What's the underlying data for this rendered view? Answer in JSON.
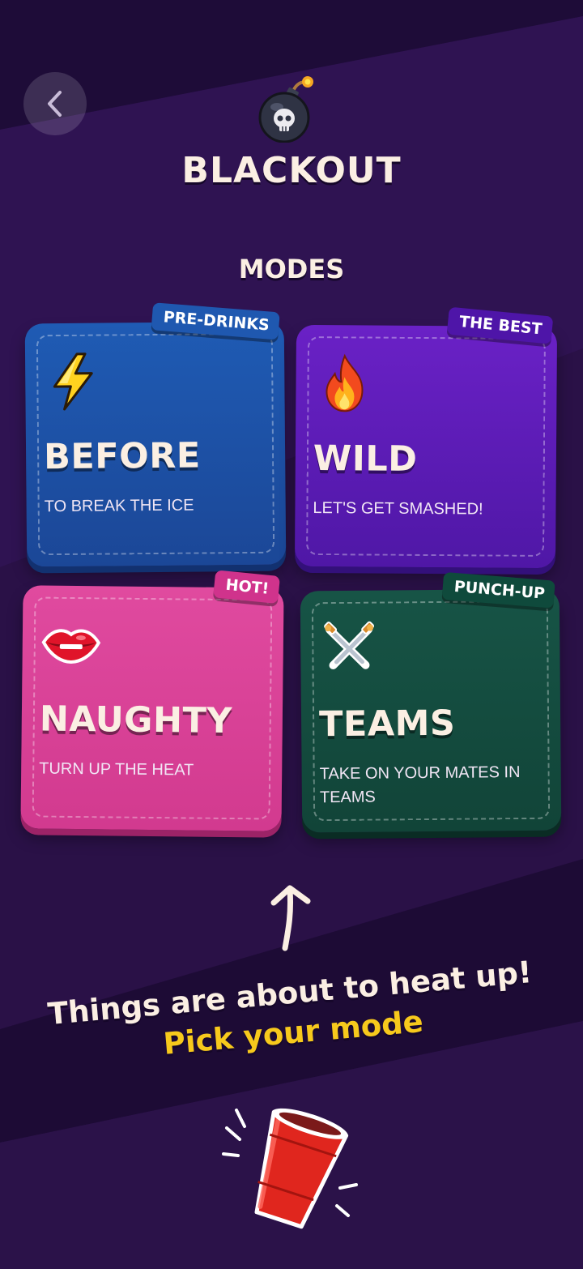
{
  "header": {
    "back_icon": "chevron-left-icon",
    "app_icon": "bomb-skull-icon",
    "title": "BLACKOUT"
  },
  "modes_section": {
    "title": "MODES",
    "cards": [
      {
        "id": "before",
        "badge": "PRE-DRINKS",
        "icon": "lightning-icon",
        "name": "BEFORE",
        "description": "TO BREAK THE ICE",
        "color": "#1f5bb4"
      },
      {
        "id": "wild",
        "badge": "THE BEST",
        "icon": "fire-icon",
        "name": "WILD",
        "description": "LET'S GET SMASHED!",
        "color": "#6a21c6"
      },
      {
        "id": "naughty",
        "badge": "HOT!",
        "icon": "lips-icon",
        "name": "NAUGHTY",
        "description": "TURN UP THE HEAT",
        "color": "#e04a9f"
      },
      {
        "id": "teams",
        "badge": "PUNCH-UP",
        "icon": "crossed-swords-icon",
        "name": "TEAMS",
        "description": "TAKE ON YOUR MATES IN TEAMS",
        "color": "#175446"
      }
    ]
  },
  "prompt": {
    "arrow_icon": "curved-arrow-up-icon",
    "line1": "Things are about to heat up!",
    "line2": "Pick your mode",
    "line2_color": "#f7c91c",
    "mascot_icon": "red-cup-icon"
  },
  "colors": {
    "background": "#2a1147",
    "text": "#fbefe3",
    "accent": "#f7c91c"
  }
}
